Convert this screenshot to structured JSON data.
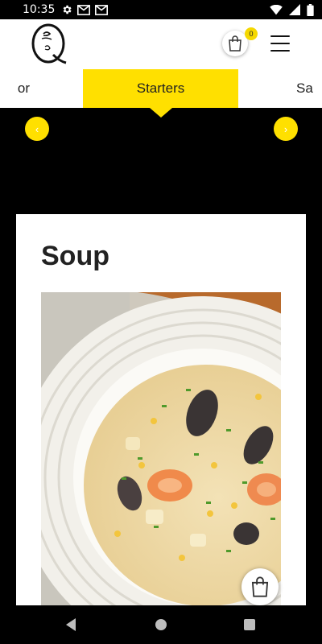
{
  "status_bar": {
    "time": "10:35",
    "left_icons": [
      "gear-icon",
      "gmail-icon",
      "gmail-icon"
    ],
    "right_icons": [
      "wifi-icon",
      "signal-icon",
      "battery-icon"
    ]
  },
  "header": {
    "logo_icon": "q-logo",
    "cart_count": "0",
    "cart_icon": "shopping-bag-icon",
    "menu_icon": "hamburger-menu-icon"
  },
  "tabs": {
    "prev_label": "or",
    "active_label": "Starters",
    "next_label": "Sa"
  },
  "arrows": {
    "left_icon": "chevron-left-icon",
    "right_icon": "chevron-right-icon"
  },
  "section": {
    "title": "Soup",
    "image_description_icon": "soup-photo"
  },
  "colors": {
    "accent": "#ffe000",
    "background": "#000000",
    "card": "#ffffff"
  }
}
